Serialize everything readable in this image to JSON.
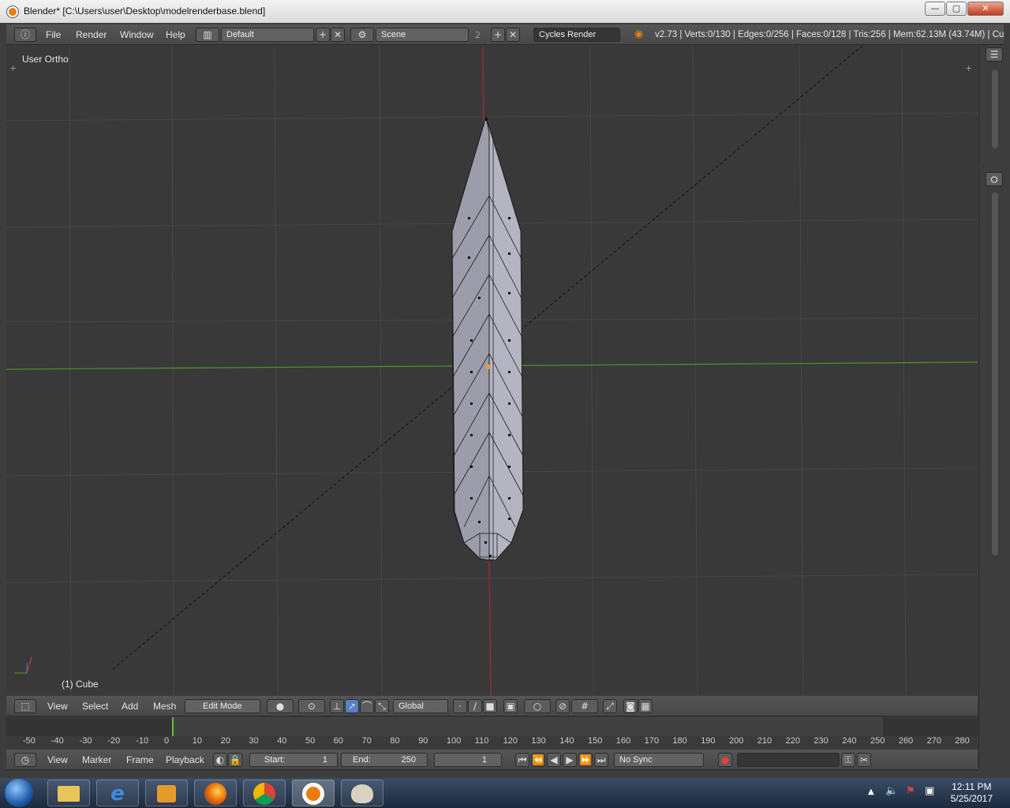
{
  "window": {
    "title": "Blender* [C:\\Users\\user\\Desktop\\modelrenderbase.blend]",
    "min": "—",
    "max": "▢",
    "close": "✕"
  },
  "info_header": {
    "menus": [
      "File",
      "Render",
      "Window",
      "Help"
    ],
    "screen_layout": "Default",
    "scene": "Scene",
    "scene_users": "2",
    "render_engine": "Cycles Render",
    "stats": "v2.73 | Verts:0/130 | Edges:0/256 | Faces:0/128 | Tris:256 | Mem:62.13M (43.74M) | Cu"
  },
  "viewport": {
    "view_name": "User Ortho",
    "object_label": "(1) Cube",
    "colors": {
      "background": "#393939",
      "grid": "#474747",
      "x_axis": "#9a2e2e",
      "y_axis": "#4c8f2a",
      "mesh": "#b4b4c2"
    }
  },
  "view3d_header": {
    "menus": [
      "View",
      "Select",
      "Add",
      "Mesh"
    ],
    "mode": "Edit Mode",
    "orientation": "Global"
  },
  "timeline": {
    "current_frame": 1,
    "ruler_ticks": [
      "-50",
      "-40",
      "-30",
      "-20",
      "-10",
      "0",
      "10",
      "20",
      "30",
      "40",
      "50",
      "60",
      "70",
      "80",
      "90",
      "100",
      "110",
      "120",
      "130",
      "140",
      "150",
      "160",
      "170",
      "180",
      "190",
      "200",
      "210",
      "220",
      "230",
      "240",
      "250",
      "260",
      "270",
      "280"
    ]
  },
  "timeline_header": {
    "menus": [
      "View",
      "Marker",
      "Frame",
      "Playback"
    ],
    "start_label": "Start:",
    "start_value": "1",
    "end_label": "End:",
    "end_value": "250",
    "frame_value": "1",
    "sync": "No Sync"
  },
  "taskbar": {
    "apps": [
      "start-orb",
      "file-explorer",
      "internet-explorer",
      "media-player",
      "firefox",
      "chrome",
      "blender",
      "paint"
    ],
    "time": "12:11 PM",
    "date": "5/25/2017"
  }
}
